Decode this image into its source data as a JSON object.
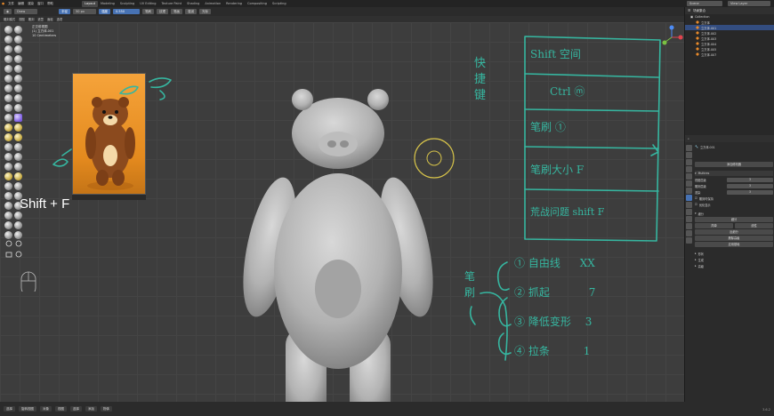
{
  "topbar": {
    "menus": [
      "文件",
      "编辑",
      "渲染",
      "窗口",
      "帮助"
    ],
    "workspace_tabs": [
      "Layout",
      "Modeling",
      "Sculpting",
      "UV Editing",
      "Texture Paint",
      "Shading",
      "Animation",
      "Rendering",
      "Compositing",
      "Scripting"
    ],
    "active_tab": "Layout",
    "scene_label": "Scene",
    "view_layer_label": "View Layer"
  },
  "tool_header": {
    "brush_name": "Draw",
    "radius_label": "半径",
    "radius_value": "50 px",
    "strength_label": "强度",
    "strength_value": "0.550",
    "options": [
      "笔刷",
      "纹理",
      "笔画",
      "衰减",
      "光标"
    ]
  },
  "mode_header": {
    "items": [
      "雕刻模式",
      "视图",
      "雕刻",
      "遮罩",
      "面组",
      "选项"
    ]
  },
  "viewport_info": {
    "line1": "正交前视图",
    "line2": "(1) 立方体.001",
    "line3": "10 Centimeters"
  },
  "overlay_caption": "Shift + F",
  "outliner": {
    "title": "场景集合",
    "collection": "Collection",
    "objects": [
      "立方体",
      "立方体.001",
      "立方体.002",
      "立方体.003",
      "立方体.004",
      "立方体.005",
      "立方体.007"
    ],
    "selected_index": 1
  },
  "properties": {
    "object_name": "立方体.001",
    "section_modifiers": "添加修改器",
    "modifier_name": "Multires",
    "rows": [
      {
        "label": "视图层级",
        "value": "3"
      },
      {
        "label": "雕刻层级",
        "value": "3"
      },
      {
        "label": "渲染",
        "value": "3"
      }
    ],
    "checkbox_labels": [
      "雕刻时保持",
      "优化显示"
    ],
    "subdivide_section": "细分",
    "buttons": [
      "细分",
      "简单",
      "线性",
      "反细分",
      "删除高级",
      "应用基础"
    ],
    "collapsed_sections": [
      "形状",
      "生成",
      "高级"
    ]
  },
  "bottombar": {
    "items": [
      "选择",
      "旋转视图",
      "对象",
      "视图",
      "选择",
      "添加",
      "物体"
    ],
    "status": "3.6.2"
  },
  "annotations": {
    "left_vertical": [
      "快",
      "捷",
      "键"
    ],
    "table_rows": [
      "Shift 空间",
      "Ctrl ⓜ",
      "笔刷 ①",
      "笔刷大小 F",
      "荒战问题 shift F"
    ],
    "numbered_list_header": "笔刷",
    "numbered_list": [
      {
        "num": "①",
        "text": "自由线",
        "key": "XX"
      },
      {
        "num": "②",
        "text": "抓起",
        "key": "7"
      },
      {
        "num": "③",
        "text": "降低变形",
        "key": "3"
      },
      {
        "num": "④",
        "text": "拉条",
        "key": "1"
      }
    ]
  },
  "colors": {
    "accent": "#4772b3",
    "handwriting": "#36b6a0",
    "selection": "#334d80",
    "viewport_bg": "#3d3d3d",
    "cursor_ring": "#d6c34a"
  }
}
